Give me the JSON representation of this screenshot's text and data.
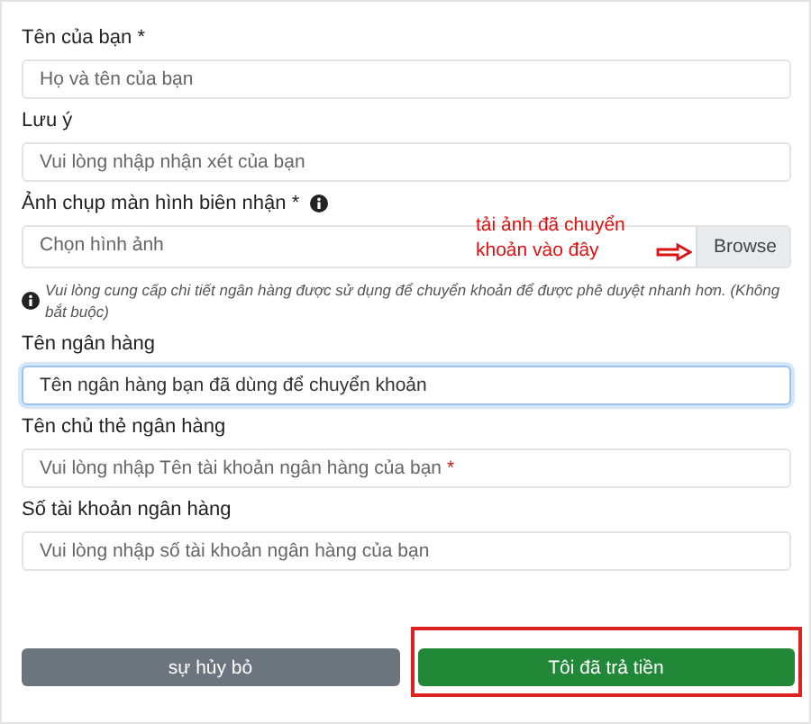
{
  "fields": [
    {
      "kind": "text",
      "label": "Tên của bạn *",
      "placeholder": "Họ và tên của bạn"
    },
    {
      "kind": "text",
      "label": "Lưu ý",
      "placeholder": "Vui lòng nhập nhận xét của bạn"
    },
    {
      "kind": "file",
      "label": "Ảnh chụp màn hình biên nhận *",
      "placeholder": "Chọn hình ảnh",
      "button": "Browse",
      "annotation": "tải ảnh đã chuyển khoản vào đây"
    },
    {
      "kind": "note",
      "text": "Vui lòng cung cấp chi tiết ngân hàng được sử dụng để chuyển khoản để được phê duyệt nhanh hơn. (Không bắt buộc)"
    },
    {
      "kind": "text",
      "label": "Tên ngân hàng",
      "value": "Tên ngân hàng bạn đã dùng để chuyển khoản",
      "focused": true
    },
    {
      "kind": "text",
      "label": "Tên chủ thẻ ngân hàng",
      "placeholder": "Vui lòng nhập Tên tài khoản ngân hàng của bạn",
      "required_mark": "*"
    },
    {
      "kind": "text",
      "label": "Số tài khoản ngân hàng",
      "placeholder": "Vui lòng nhập số tài khoản ngân hàng của bạn"
    }
  ],
  "buttons": [
    {
      "kind": "secondary",
      "label": "sự hủy bỏ",
      "highlighted": false
    },
    {
      "kind": "primary",
      "label": "Tôi đã trả tiền",
      "highlighted": true
    }
  ]
}
